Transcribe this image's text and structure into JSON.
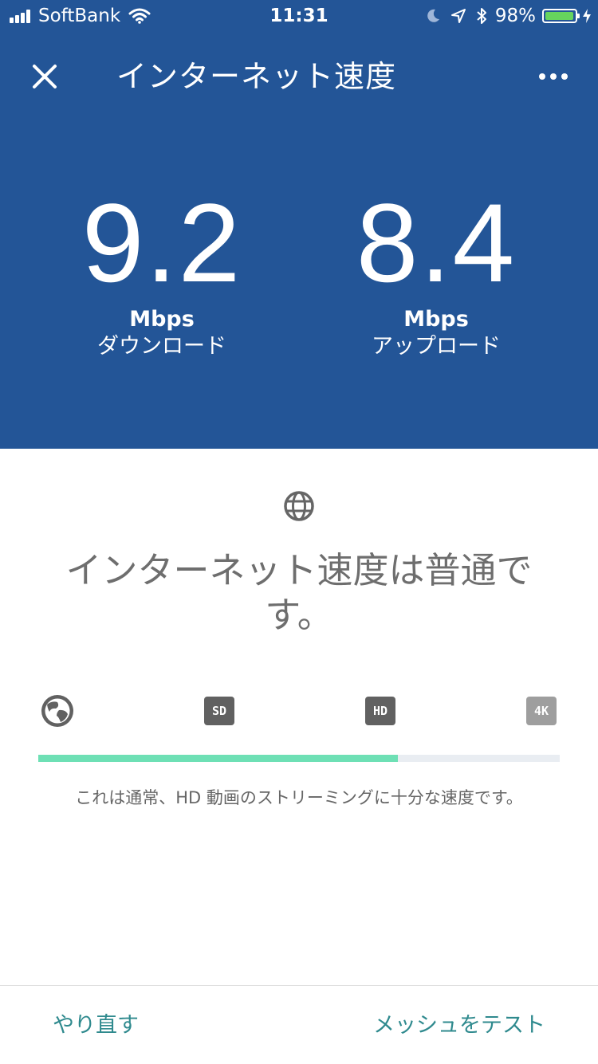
{
  "status_bar": {
    "carrier": "SoftBank",
    "time": "11:31",
    "battery": "98%",
    "battery_level": 0.98
  },
  "header": {
    "title": "インターネット速度"
  },
  "metrics": {
    "download": {
      "value": "9.2",
      "unit": "Mbps",
      "label": "ダウンロード"
    },
    "upload": {
      "value": "8.4",
      "unit": "Mbps",
      "label": "アップロード"
    }
  },
  "result": {
    "message": "インターネット速度は普通です。",
    "tiers": [
      "SD",
      "HD",
      "4K"
    ],
    "progress": 0.69,
    "description": "これは通常、HD 動画のストリーミングに十分な速度です。"
  },
  "footer": {
    "retry_label": "やり直す",
    "mesh_label": "メッシュをテスト"
  },
  "colors": {
    "header_bg": "#235597",
    "progress_fill": "#6ee0b5",
    "action": "#2f8a8e"
  }
}
